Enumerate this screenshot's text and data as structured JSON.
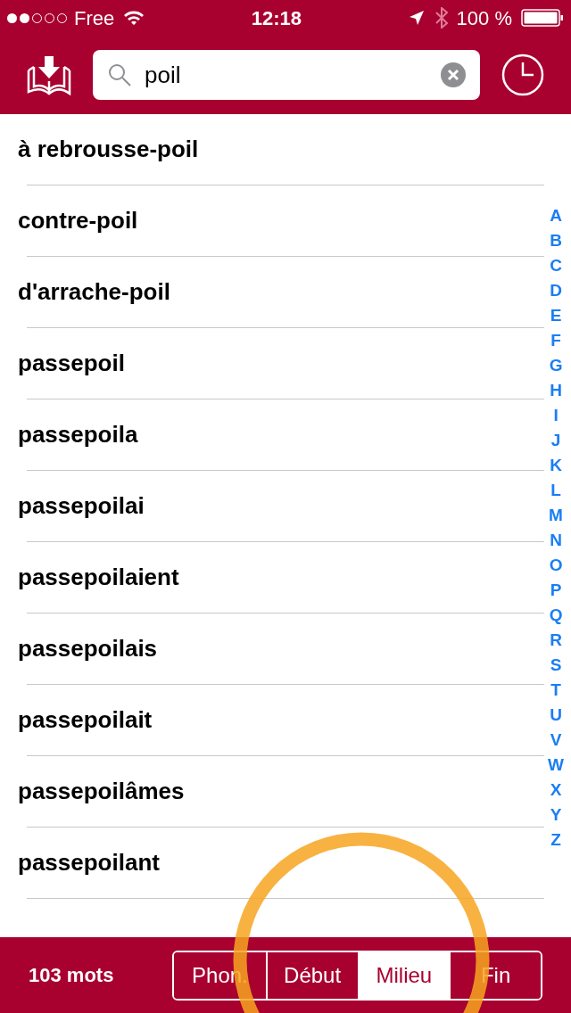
{
  "status_bar": {
    "signal_dots": [
      {
        "filled": true
      },
      {
        "filled": true
      },
      {
        "filled": false
      },
      {
        "filled": false
      },
      {
        "filled": false
      }
    ],
    "carrier": "Free",
    "time": "12:18",
    "bluetooth_connected": false,
    "battery": "100 %"
  },
  "search": {
    "value": "poil"
  },
  "results": [
    {
      "word": "à rebrousse-poil"
    },
    {
      "word": "contre-poil"
    },
    {
      "word": "d'arrache-poil"
    },
    {
      "word": "passepoil"
    },
    {
      "word": "passepoila"
    },
    {
      "word": "passepoilai"
    },
    {
      "word": "passepoilaient"
    },
    {
      "word": "passepoilais"
    },
    {
      "word": "passepoilait"
    },
    {
      "word": "passepoilâmes"
    },
    {
      "word": "passepoilant"
    }
  ],
  "index": [
    "A",
    "B",
    "C",
    "D",
    "E",
    "F",
    "G",
    "H",
    "I",
    "J",
    "K",
    "L",
    "M",
    "N",
    "O",
    "P",
    "Q",
    "R",
    "S",
    "T",
    "U",
    "V",
    "W",
    "X",
    "Y",
    "Z"
  ],
  "bottom_bar": {
    "count": "103 mots",
    "segments": [
      {
        "label": "Phon.",
        "selected": false
      },
      {
        "label": "Début",
        "selected": false
      },
      {
        "label": "Milieu",
        "selected": true
      },
      {
        "label": "Fin",
        "selected": false
      }
    ]
  }
}
